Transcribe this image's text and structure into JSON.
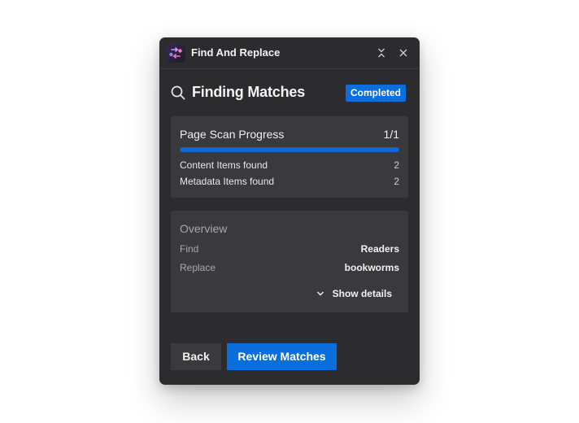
{
  "window": {
    "title": "Find And Replace",
    "app_icon": "find-replace-app-icon",
    "controls": {
      "collapse_icon": "collapse-icon",
      "close_icon": "close-icon"
    }
  },
  "header": {
    "icon": "search-icon",
    "title": "Finding Matches",
    "status_badge": "Completed"
  },
  "progress_card": {
    "title": "Page Scan Progress",
    "count": "1/1",
    "progress_fraction": 1.0,
    "rows": [
      {
        "label": "Content Items found",
        "value": "2"
      },
      {
        "label": "Metadata Items found",
        "value": "2"
      }
    ]
  },
  "overview_card": {
    "title": "Overview",
    "rows": [
      {
        "label": "Find",
        "value": "Readers"
      },
      {
        "label": "Replace",
        "value": "bookworms"
      }
    ],
    "show_details_label": "Show details",
    "show_details_icon": "chevron-down-icon"
  },
  "footer": {
    "back_label": "Back",
    "review_label": "Review Matches"
  },
  "colors": {
    "window_bg": "#2c2c2e",
    "card_bg": "#3a3a3c",
    "accent": "#0a6edc"
  }
}
